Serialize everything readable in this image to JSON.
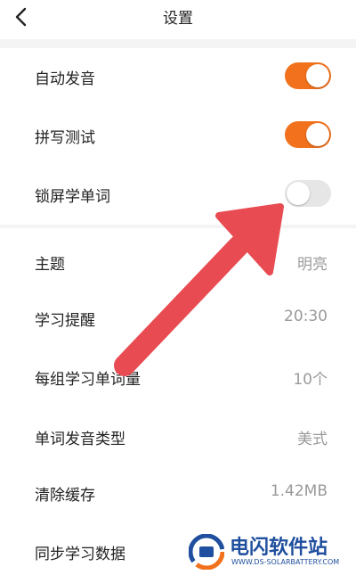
{
  "header": {
    "title": "设置"
  },
  "toggles": [
    {
      "label": "自动发音",
      "state": "on"
    },
    {
      "label": "拼写测试",
      "state": "on"
    },
    {
      "label": "锁屏学单词",
      "state": "off"
    }
  ],
  "settings": [
    {
      "label": "主题",
      "value": "明亮"
    },
    {
      "label": "学习提醒",
      "value": "20:30"
    },
    {
      "label": "每组学习单词量",
      "value": "10个"
    },
    {
      "label": "单词发音类型",
      "value": "美式"
    },
    {
      "label": "清除缓存",
      "value": "1.42MB"
    },
    {
      "label": "同步学习数据",
      "value": ""
    }
  ],
  "colors": {
    "accent": "#f2711c",
    "annotation": "#e84b52",
    "watermark": "#1f4f9e"
  },
  "watermark": {
    "title": "电闪软件站",
    "url": "WWW.DS-SOLARBATTERY.COM"
  }
}
